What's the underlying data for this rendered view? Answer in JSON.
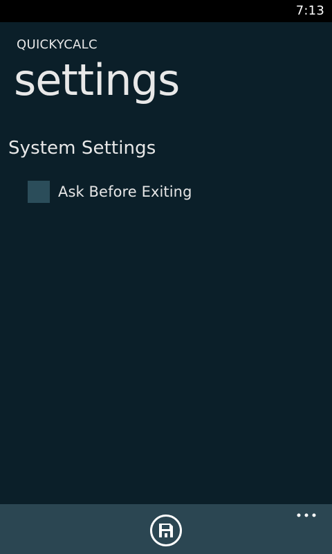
{
  "status_bar": {
    "time": "7:13"
  },
  "header": {
    "app_title": "QUICKYCALC",
    "page_title": "settings"
  },
  "section": {
    "title": "System Settings",
    "items": [
      {
        "label": "Ask Before Exiting",
        "checked": false
      }
    ]
  },
  "app_bar": {
    "buttons": [
      {
        "icon": "save-icon"
      }
    ],
    "more_icon": "ellipsis-icon"
  },
  "colors": {
    "background": "#0b1f29",
    "status_bar": "#000000",
    "checkbox": "#2b4d5a",
    "app_bar": "#2b4652",
    "text": "#e8e8e8"
  }
}
